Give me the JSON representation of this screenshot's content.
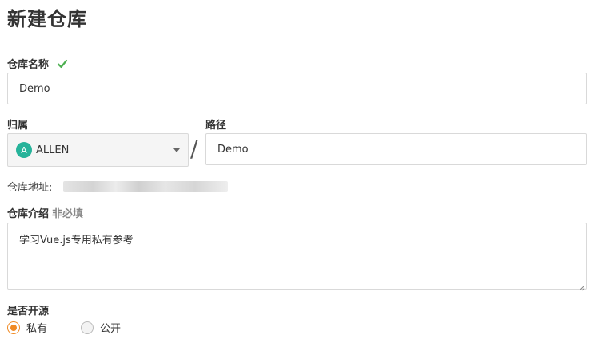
{
  "page": {
    "title": "新建仓库"
  },
  "repo_name": {
    "label": "仓库名称",
    "value": "Demo",
    "status_color": "#4caf50"
  },
  "owner": {
    "label": "归属",
    "avatar_letter": "A",
    "value": "ALLEN",
    "avatar_color": "#26b39a"
  },
  "path": {
    "label": "路径",
    "value": "Demo",
    "separator": "/"
  },
  "address": {
    "label": "仓库地址:"
  },
  "description": {
    "label": "仓库介绍",
    "optional": "非必填",
    "value": "学习Vue.js专用私有参考"
  },
  "visibility": {
    "label": "是否开源",
    "options": [
      {
        "label": "私有",
        "checked": true
      },
      {
        "label": "公开",
        "checked": false
      }
    ],
    "accent_color": "#f08a24"
  }
}
